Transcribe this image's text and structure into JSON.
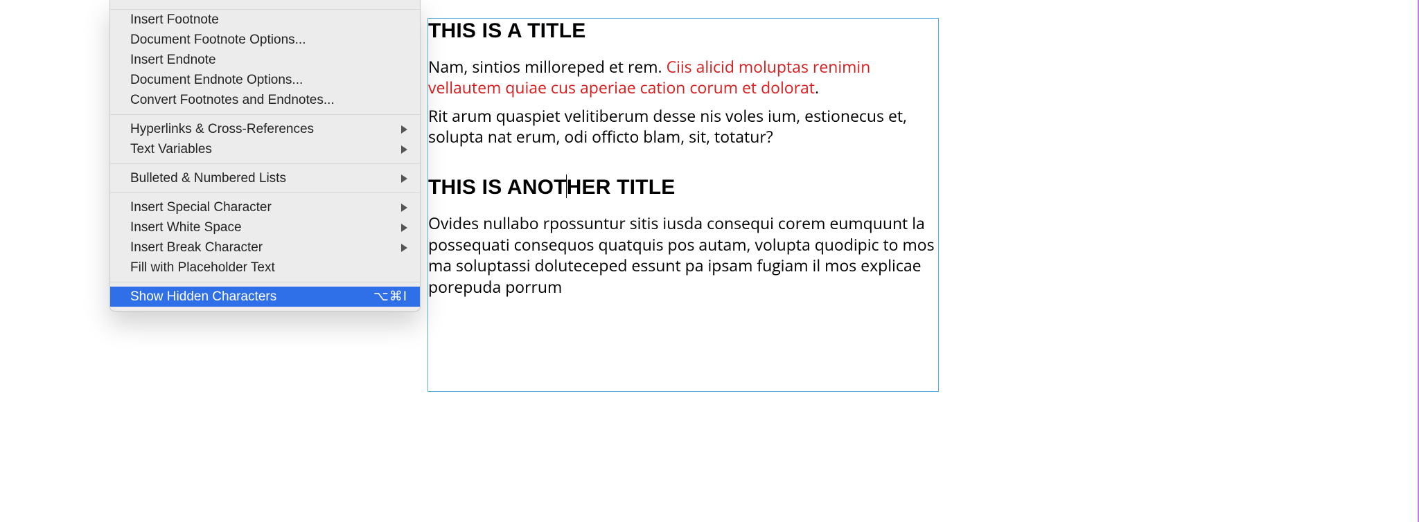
{
  "menu": {
    "group1": [
      "Insert Footnote",
      "Document Footnote Options...",
      "Insert Endnote",
      "Document Endnote Options...",
      "Convert Footnotes and Endnotes..."
    ],
    "group2": [
      "Hyperlinks & Cross-References",
      "Text Variables"
    ],
    "group3": [
      "Bulleted & Numbered Lists"
    ],
    "group4": [
      "Insert Special Character",
      "Insert White Space",
      "Insert Break Character",
      "Fill with Placeholder Text"
    ],
    "highlighted": {
      "label": "Show Hidden Characters",
      "shortcut": "⌥⌘I"
    }
  },
  "frame": {
    "title1": "THIS IS A TITLE",
    "para1a": "Nam, sintios milloreped et rem. ",
    "para1b": "Ciis alicid moluptas renimin vellautem quiae cus aperiae cation corum et dolorat",
    "para1c": ".",
    "para2": "Rit arum quaspiet velitiberum desse nis voles ium, estionecus et, solupta nat erum, odi officto blam, sit, totatur?",
    "title2a": "THIS IS ANOT",
    "title2b": "HER TITLE",
    "para3": "Ovides nullabo rpossuntur sitis iusda consequi corem eumquunt la possequati consequos quatquis pos autam, volupta quodipic to mos ma soluptassi doluteceped essunt pa ipsam fugiam il mos explicae porepuda porrum"
  }
}
